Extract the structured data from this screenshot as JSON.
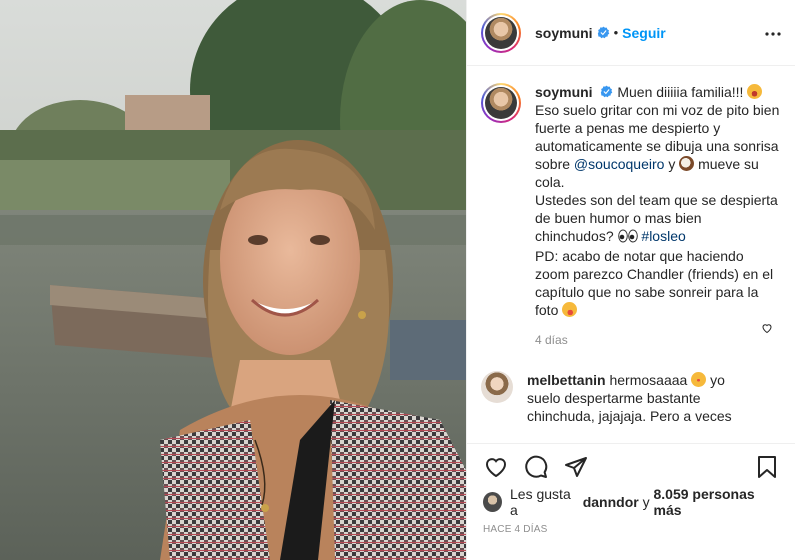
{
  "post": {
    "username": "soymuni",
    "follow_label": "Seguir",
    "dot": "•"
  },
  "caption": {
    "username": "soymuni",
    "p1": "Muen diiiiia familia!!!",
    "p2": "Eso suelo gritar con mi voz de pito bien fuerte a penas me despierto y automaticamente se dibuja una sonrisa sobre",
    "mention": "@soucoqueiro",
    "p3": "y",
    "p4": "mueve su cola.",
    "p5": "Ustedes son del team que se despierta de buen humor o mas bien chinchudos?",
    "hashtag": "#losleo",
    "p6": "PD: acabo de notar que haciendo zoom parezco Chandler (friends) en el capítulo que no sabe sonreir para la foto",
    "age": "4 días"
  },
  "comment": {
    "username": "melbettanin",
    "text1": "hermosaaaa",
    "text2": "yo suelo despertarme bastante chinchuda, jajajaja. Pero a veces"
  },
  "likes": {
    "prefix": "Les gusta a",
    "user": "danndor",
    "joiner": "y",
    "count": "8.059 personas más"
  },
  "date": "HACE 4 DÍAS",
  "colors": {
    "accent": "#0095f6",
    "link": "#00376b",
    "muted": "#8e8e8e"
  }
}
